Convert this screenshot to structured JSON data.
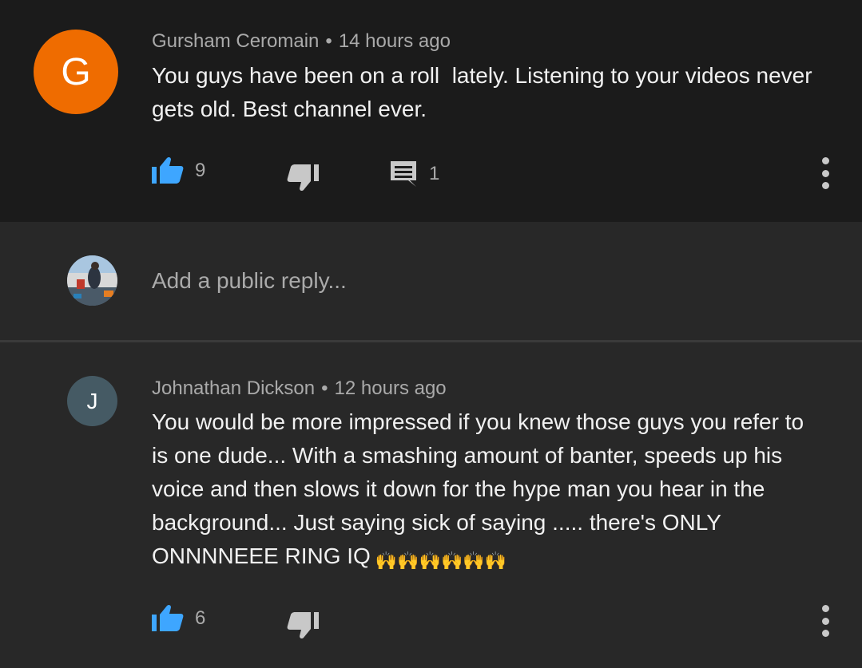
{
  "comments": [
    {
      "author": "Gursham Ceromain",
      "separator": "•",
      "time": "14 hours ago",
      "text": "You guys have been on a roll  lately. Listening to your videos never\ngets old. Best channel ever.",
      "avatar_letter": "G",
      "avatar_color": "#ef6c00",
      "likes": "9",
      "replies": "1"
    },
    {
      "author": "Johnathan Dickson",
      "separator": "•",
      "time": "12 hours ago",
      "text": "You would be more impressed if you knew those guys you refer to\nis one dude... With a smashing amount of banter, speeds up his\nvoice and then slows it down for the hype man you hear in the\nbackground... Just saying sick of saying ..... there's ONLY\nONNNNEEE RING IQ",
      "emoji": "🙌🙌🙌🙌🙌🙌",
      "avatar_letter": "J",
      "avatar_color": "#455a64",
      "likes": "6"
    }
  ],
  "reply": {
    "placeholder": "Add a public reply..."
  },
  "icons": {
    "like": "thumb-up-icon",
    "dislike": "thumb-down-icon",
    "reply": "comment-icon",
    "more": "more-vert-icon"
  },
  "colors": {
    "like_blue": "#3ea6ff",
    "text_secondary": "#aaaaaa"
  }
}
